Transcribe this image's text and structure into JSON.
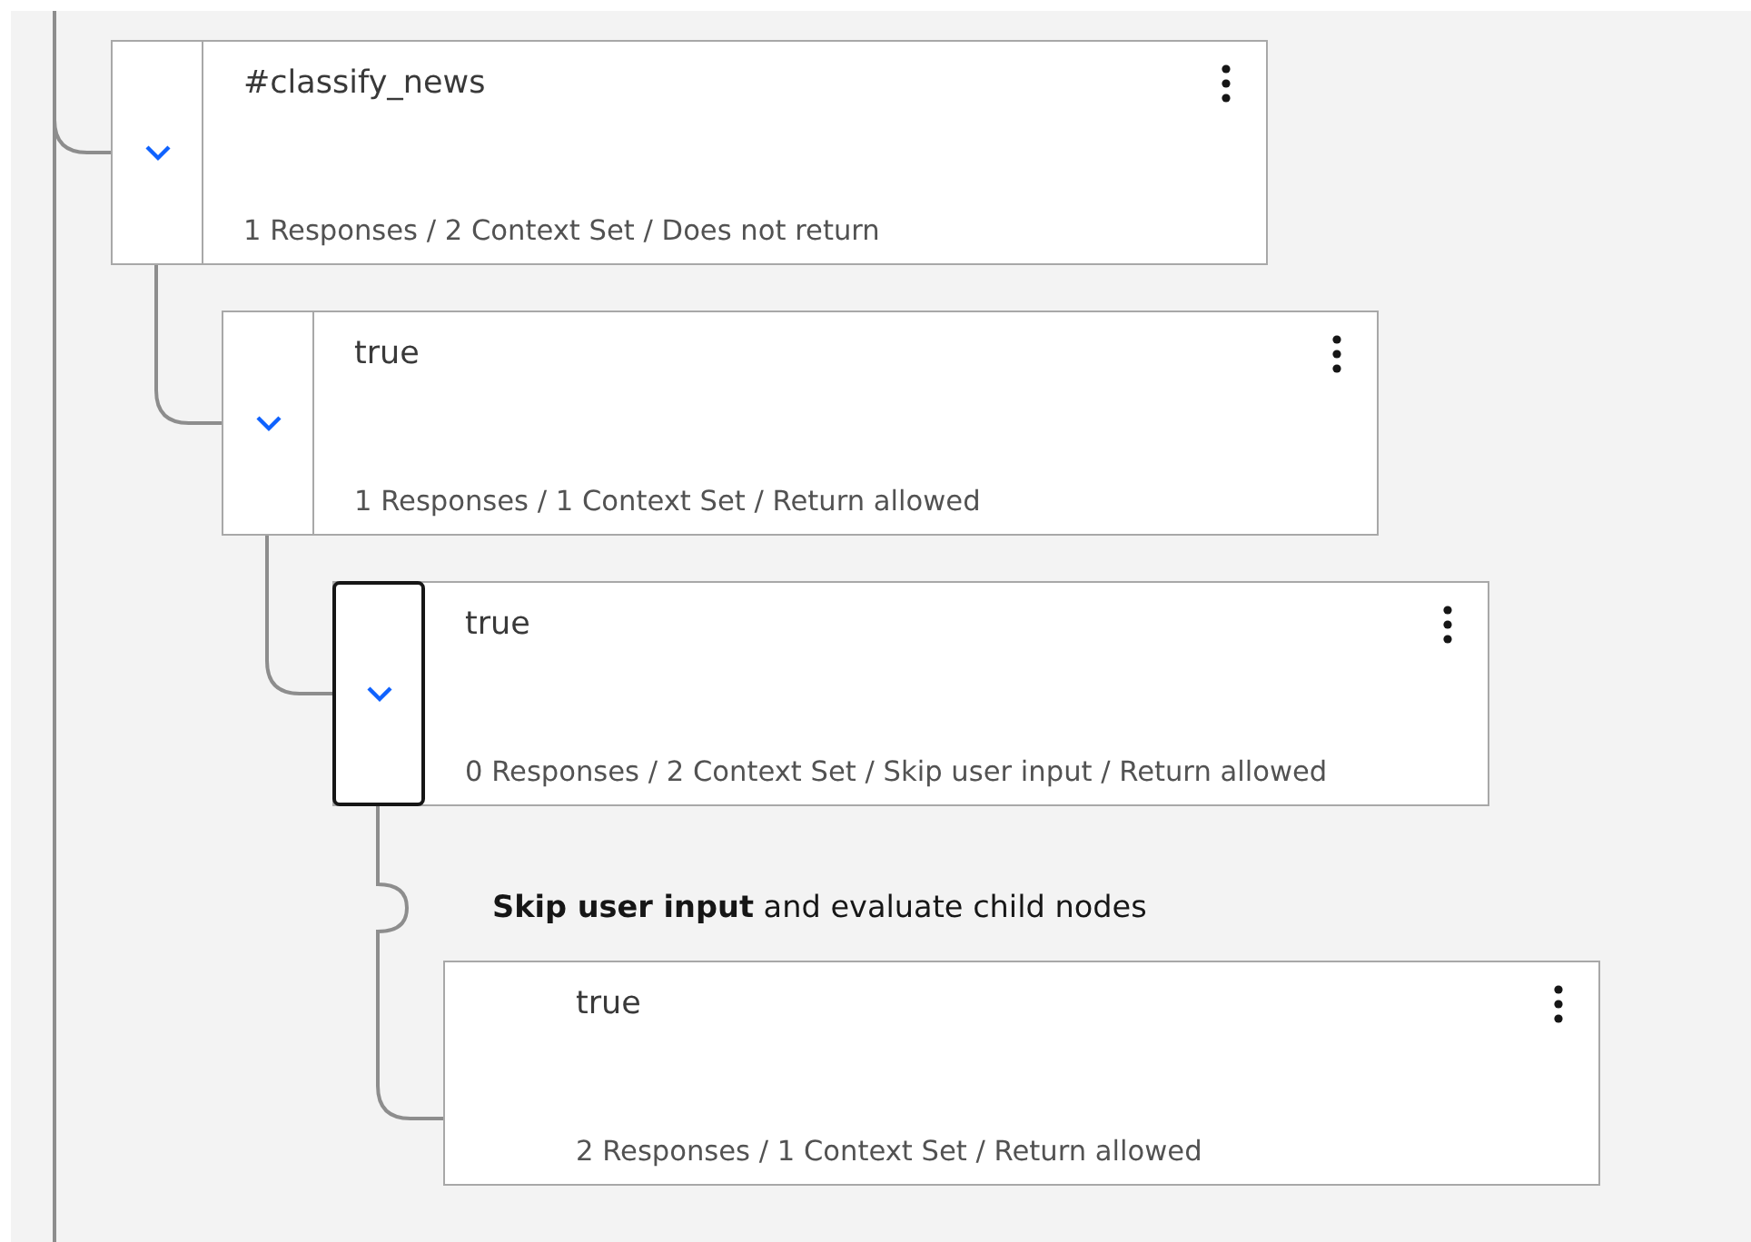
{
  "tree": [
    {
      "kind": "node",
      "title": "#classify_news",
      "summary": "1 Responses / 2 Context Set / Does not return",
      "expanded": true,
      "focused": false,
      "children": [
        {
          "kind": "node",
          "title": "true",
          "summary": "1 Responses / 1 Context Set / Return allowed",
          "expanded": true,
          "focused": false,
          "children": [
            {
              "kind": "node",
              "title": "true",
              "summary": "0 Responses / 2 Context Set / Skip user input / Return allowed",
              "expanded": true,
              "focused": true,
              "skip_note": "**Skip user input** and evaluate child nodes",
              "children": [
                {
                  "kind": "leaf",
                  "title": "true",
                  "summary": "2 Responses / 1 Context Set / Return allowed",
                  "focused": false
                }
              ]
            }
          ]
        }
      ]
    }
  ]
}
